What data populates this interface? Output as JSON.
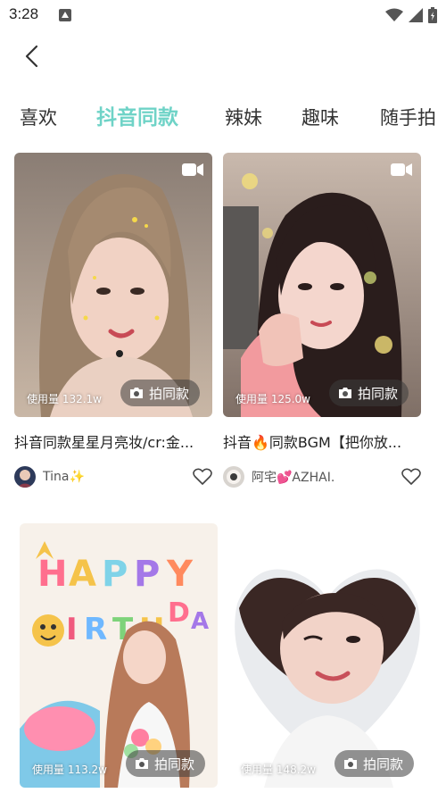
{
  "status_bar": {
    "time": "3:28"
  },
  "tabs": [
    {
      "label": "喜欢",
      "active": false
    },
    {
      "label": "抖音同款",
      "active": true
    },
    {
      "label": "辣妹",
      "active": false
    },
    {
      "label": "趣味",
      "active": false
    },
    {
      "label": "随手拍",
      "active": false
    }
  ],
  "feed": [
    {
      "usage": "使用量 132.1w",
      "shoot_label": "拍同款",
      "title": "抖音同款星星月亮妆/cr:金...",
      "author": "Tina✨"
    },
    {
      "usage": "使用量 125.0w",
      "shoot_label": "拍同款",
      "title": "抖音🔥同款BGM【把你放...",
      "author": "阿宅💕AZHAI."
    },
    {
      "usage": "使用量 113.2w",
      "shoot_label": "拍同款"
    },
    {
      "usage": "使用量 148.2w",
      "shoot_label": "拍同款"
    }
  ],
  "colors": {
    "accent": "#6fd3c7",
    "text": "#222222",
    "overlay": "rgba(60,60,60,0.55)"
  },
  "icons": [
    "back-arrow-icon",
    "video-camera-icon",
    "camera-icon",
    "heart-outline-icon",
    "wifi-icon",
    "signal-icon",
    "battery-icon"
  ]
}
